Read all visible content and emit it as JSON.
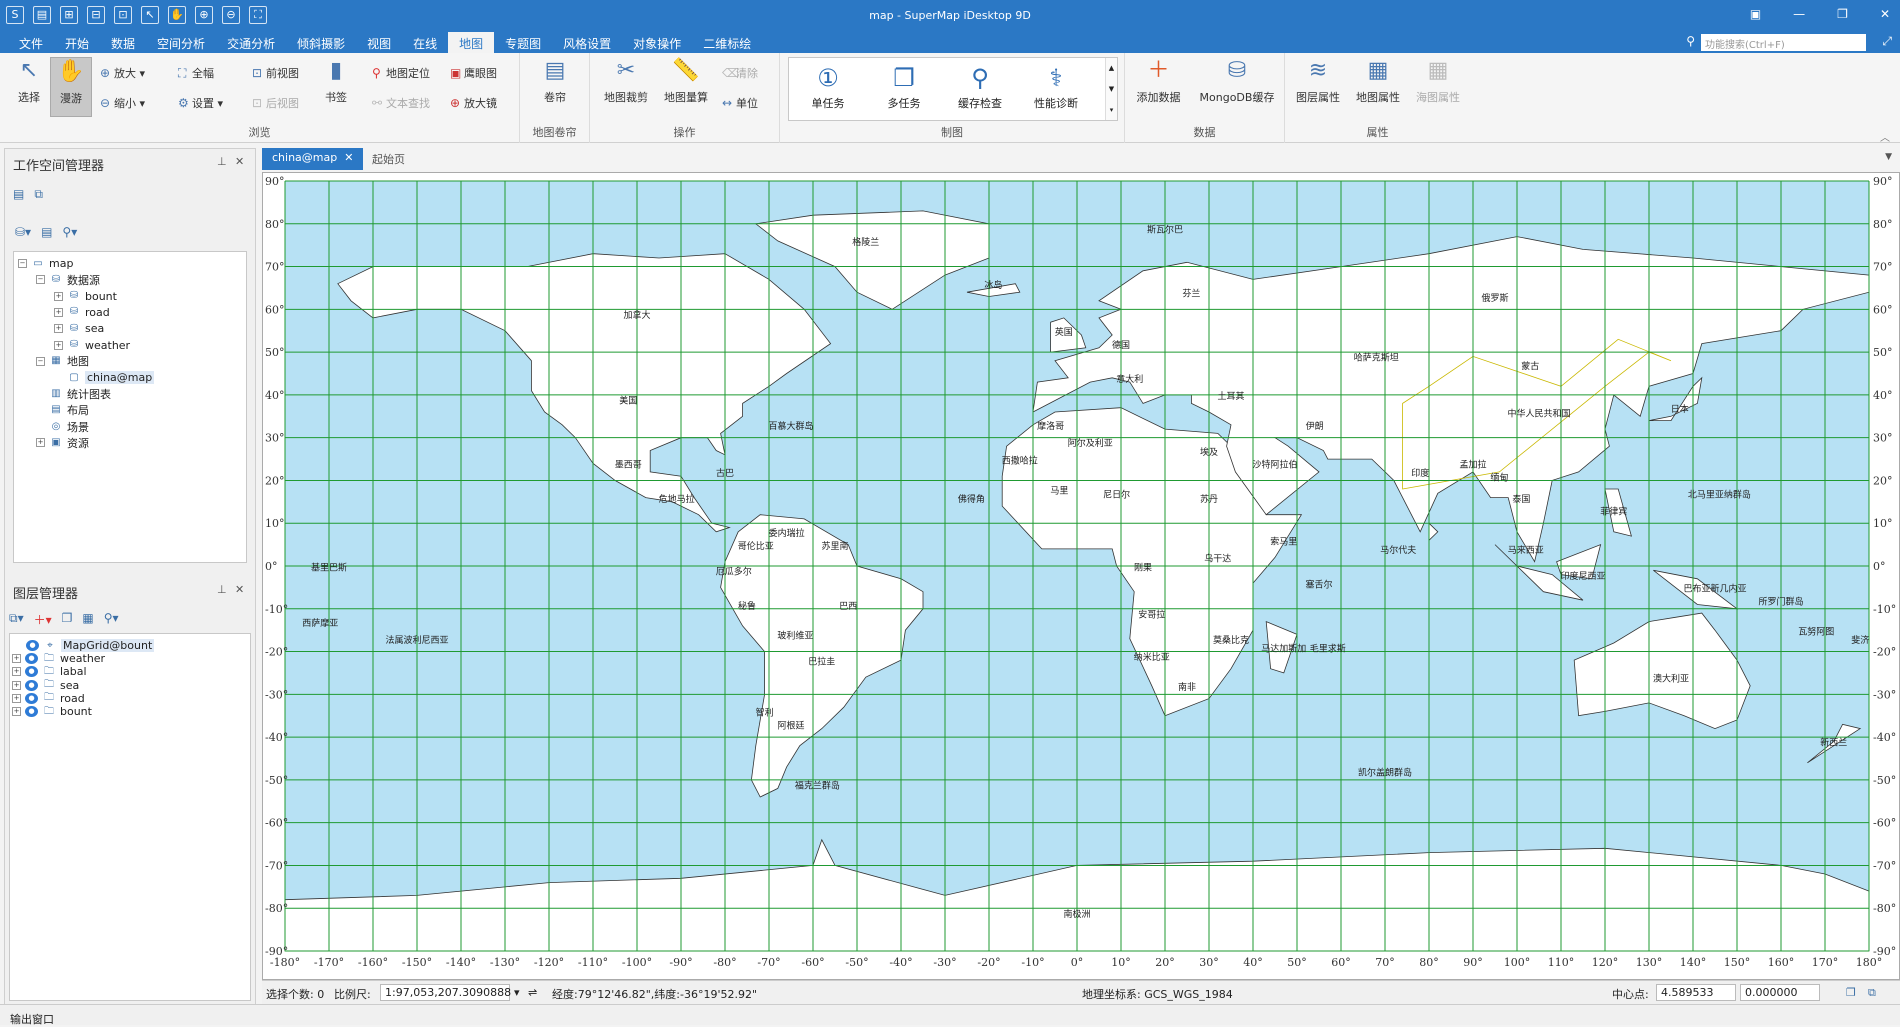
{
  "app": {
    "title": "map - SuperMap iDesktop 9D",
    "window_controls": [
      "▣",
      "—",
      "❐",
      "✕"
    ]
  },
  "menu": {
    "tabs": [
      "文件",
      "开始",
      "数据",
      "空间分析",
      "交通分析",
      "倾斜摄影",
      "视图",
      "在线",
      "地图",
      "专题图",
      "风格设置",
      "对象操作",
      "二维标绘"
    ],
    "active_index": 8,
    "search_placeholder": "功能搜索(Ctrl+F)"
  },
  "ribbon": {
    "browse": {
      "label": "浏览",
      "select": "选择",
      "pan": "漫游",
      "zoom_in": "放大",
      "zoom_out": "缩小",
      "full": "全幅",
      "settings": "设置",
      "prev_view": "前视图",
      "next_view": "后视图",
      "bookmark": "书签"
    },
    "locate": {
      "map_locate": "地图定位",
      "text_find": "文本查找",
      "eagle_eye": "鹰眼图",
      "magnifier": "放大镜"
    },
    "swipe": {
      "label": "地图卷帘",
      "btn": "卷帘"
    },
    "operate": {
      "label": "操作",
      "clip": "地图裁剪",
      "measure": "地图量算",
      "clear": "清除",
      "unit": "单位"
    },
    "cartography": {
      "label": "制图",
      "items": [
        "单任务",
        "多任务",
        "缓存检查",
        "性能诊断"
      ]
    },
    "data": {
      "label": "数据",
      "add": "添加数据",
      "mongo": "MongoDB缓存"
    },
    "props": {
      "label": "属性",
      "layer": "图层属性",
      "map": "地图属性",
      "chart": "海图属性"
    }
  },
  "workspace": {
    "title": "工作空间管理器",
    "tree": [
      {
        "label": "map",
        "level": 0,
        "icon": "workspace-icon"
      },
      {
        "label": "数据源",
        "level": 1,
        "icon": "datasources-icon"
      },
      {
        "label": "bount",
        "level": 2,
        "icon": "datasource-icon"
      },
      {
        "label": "road",
        "level": 2,
        "icon": "datasource-icon"
      },
      {
        "label": "sea",
        "level": 2,
        "icon": "datasource-icon"
      },
      {
        "label": "weather",
        "level": 2,
        "icon": "datasource-icon"
      },
      {
        "label": "地图",
        "level": 1,
        "icon": "maps-icon"
      },
      {
        "label": "china@map",
        "level": 2,
        "icon": "map-icon"
      },
      {
        "label": "统计图表",
        "level": 1,
        "icon": "chart-icon"
      },
      {
        "label": "布局",
        "level": 1,
        "icon": "layout-icon"
      },
      {
        "label": "场景",
        "level": 1,
        "icon": "scene-icon"
      },
      {
        "label": "资源",
        "level": 1,
        "icon": "resource-icon"
      }
    ]
  },
  "layers": {
    "title": "图层管理器",
    "items": [
      "MapGrid@bount",
      "weather",
      "labal",
      "sea",
      "road",
      "bount"
    ]
  },
  "tabs": [
    "china@map",
    "起始页"
  ],
  "map": {
    "lat_labels": [
      "90°",
      "80°",
      "70°",
      "60°",
      "50°",
      "40°",
      "30°",
      "20°",
      "10°",
      "0°",
      "-10°",
      "-20°",
      "-30°",
      "-40°",
      "-50°",
      "-60°",
      "-70°",
      "-80°",
      "-90°"
    ],
    "lon_labels": [
      "-180°",
      "-170°",
      "-160°",
      "-150°",
      "-140°",
      "-130°",
      "-120°",
      "-110°",
      "-100°",
      "-90°",
      "-80°",
      "-70°",
      "-60°",
      "-50°",
      "-40°",
      "-30°",
      "-20°",
      "-10°",
      "0°",
      "10°",
      "20°",
      "30°",
      "40°",
      "50°",
      "60°",
      "70°",
      "80°",
      "90°",
      "100°",
      "110°",
      "120°",
      "130°",
      "140°",
      "150°",
      "160°",
      "170°",
      "180°"
    ],
    "place_labels": [
      "格陵兰",
      "斯瓦尔巴",
      "加拿大",
      "美国",
      "墨西哥",
      "古巴",
      "百慕大群岛",
      "危地马拉",
      "委内瑞拉",
      "哥伦比亚",
      "苏里南",
      "厄瓜多尔",
      "秘鲁",
      "玻利维亚",
      "巴西",
      "巴拉圭",
      "智利",
      "阿根廷",
      "福克兰群岛",
      "法属波利尼西亚",
      "西萨摩亚",
      "基里巴斯",
      "俄罗斯",
      "哈萨克斯坦",
      "蒙古",
      "中华人民共和国",
      "日本",
      "印度",
      "孟加拉",
      "缅甸",
      "泰国",
      "菲律宾",
      "马来西亚",
      "印度尼西亚",
      "巴布亚新几内亚",
      "所罗门群岛",
      "瓦努阿图",
      "斐济",
      "澳大利亚",
      "新西兰",
      "北马里亚纳群岛",
      "马尔代夫",
      "塞舌尔",
      "毛里求斯",
      "马达加斯加",
      "莫桑比克",
      "南非",
      "纳米比亚",
      "安哥拉",
      "刚果",
      "埃及",
      "苏丹",
      "乌干达",
      "索马里",
      "沙特阿拉伯",
      "伊朗",
      "土耳其",
      "阿尔及利亚",
      "马里",
      "尼日尔",
      "冰岛",
      "英国",
      "德国",
      "意大利",
      "芬兰",
      "南极洲",
      "凯尔盖朗群岛",
      "佛得角",
      "西撒哈拉",
      "摩洛哥"
    ]
  },
  "status": {
    "select_label": "选择个数: 0",
    "scale_label": "比例尺:",
    "scale_value": "1:97,053,207.3090888",
    "coords": "经度:79°12'46.82\",纬度:-36°19'52.92\"",
    "crs": "地理坐标系: GCS_WGS_1984",
    "center_label": "中心点:",
    "center_x": "4.589533",
    "center_y": "0.000000"
  },
  "output_window": "输出窗口",
  "colors": {
    "accent": "#2b78c5",
    "sea": "#b7e1f4",
    "grid": "#1f9a31",
    "land": "#ffffff",
    "china": "#c9b800"
  }
}
